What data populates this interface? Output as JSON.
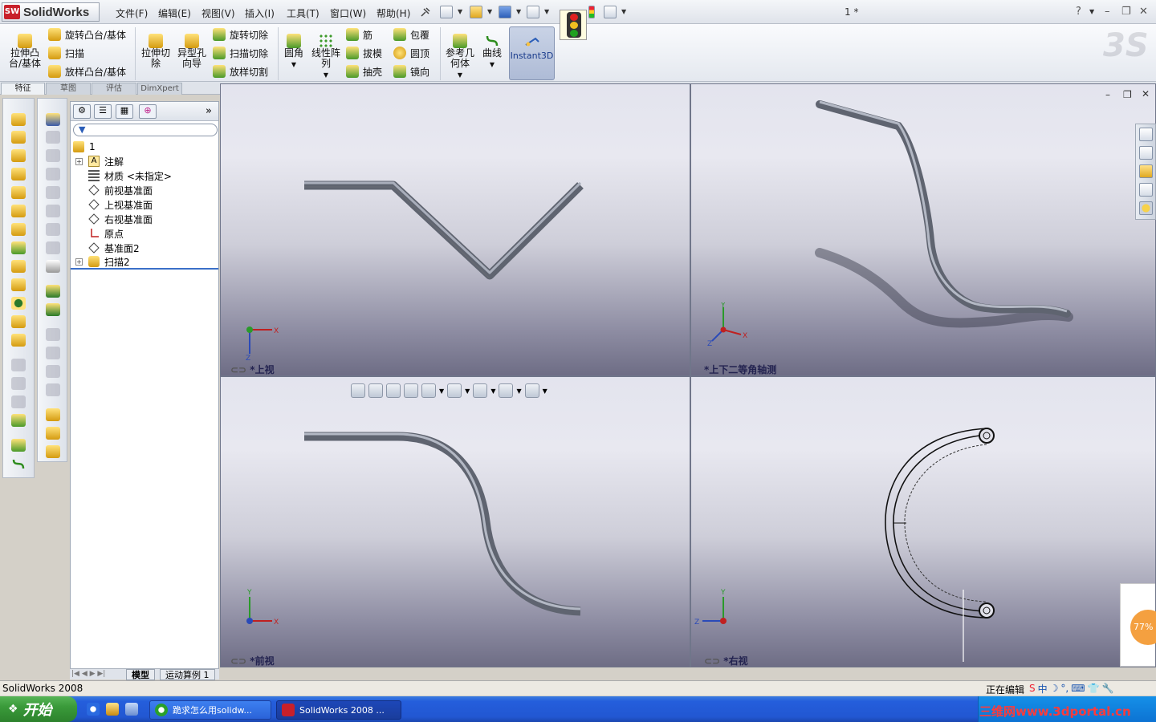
{
  "app": {
    "name": "SolidWorks",
    "doc_title": "1 *"
  },
  "menu": [
    "文件(F)",
    "编辑(E)",
    "视图(V)",
    "插入(I)",
    "工具(T)",
    "窗口(W)",
    "帮助(H)"
  ],
  "window_controls": {
    "help": "?",
    "minimize": "–",
    "restore": "❐",
    "close": "✕"
  },
  "features": {
    "extrude_boss": "拉伸凸\n台/基体",
    "revolve_boss": "旋转凸台/基体",
    "sweep": "扫描",
    "loft": "放样凸台/基体",
    "extrude_cut": "拉伸切\n除",
    "hole_wizard": "异型孔\n向导",
    "revolve_cut": "旋转切除",
    "sweep_cut": "扫描切除",
    "loft_cut": "放样切割",
    "fillet": "圆角",
    "linear_pattern": "线性阵\n列",
    "rib": "筋",
    "draft": "拔模",
    "shell": "抽壳",
    "wrap": "包覆",
    "dome": "圆顶",
    "mirror": "镜向",
    "ref_geometry": "参考几\n何体",
    "curves": "曲线",
    "instant3d": "Instant3D"
  },
  "cmd_tabs": [
    "特征",
    "草图",
    "评估",
    "DimXpert"
  ],
  "tree": {
    "root": "1",
    "items": [
      {
        "label": "注解",
        "expand": "+"
      },
      {
        "label": "材质 <未指定>",
        "expand": ""
      },
      {
        "label": "前视基准面",
        "expand": ""
      },
      {
        "label": "上视基准面",
        "expand": ""
      },
      {
        "label": "右视基准面",
        "expand": ""
      },
      {
        "label": "原点",
        "expand": ""
      },
      {
        "label": "基准面2",
        "expand": ""
      },
      {
        "label": "扫描2",
        "expand": "+"
      }
    ],
    "more": "»"
  },
  "bottom_tabs": [
    "模型",
    "运动算例 1"
  ],
  "viewports": {
    "top": "*上视",
    "iso": "*上下二等角轴测",
    "front": "*前视",
    "right": "*右视"
  },
  "axes": {
    "x": "X",
    "y": "Y",
    "z": "Z"
  },
  "zoom_percent": "77%",
  "status": {
    "left": "SolidWorks 2008",
    "right": "正在编辑"
  },
  "ime": [
    "S",
    "中",
    "☽",
    "°,",
    "⌨",
    "👕",
    "🔧"
  ],
  "taskbar": {
    "start": "开始",
    "tasks": [
      "跪求怎么用solidw...",
      "SolidWorks 2008 ..."
    ]
  },
  "watermark": "三维网www.3dportal.cn",
  "colors": {
    "accent_blue": "#245edc",
    "solidworks_red": "#c8202a",
    "tube_gray": "#7a7f8a"
  }
}
